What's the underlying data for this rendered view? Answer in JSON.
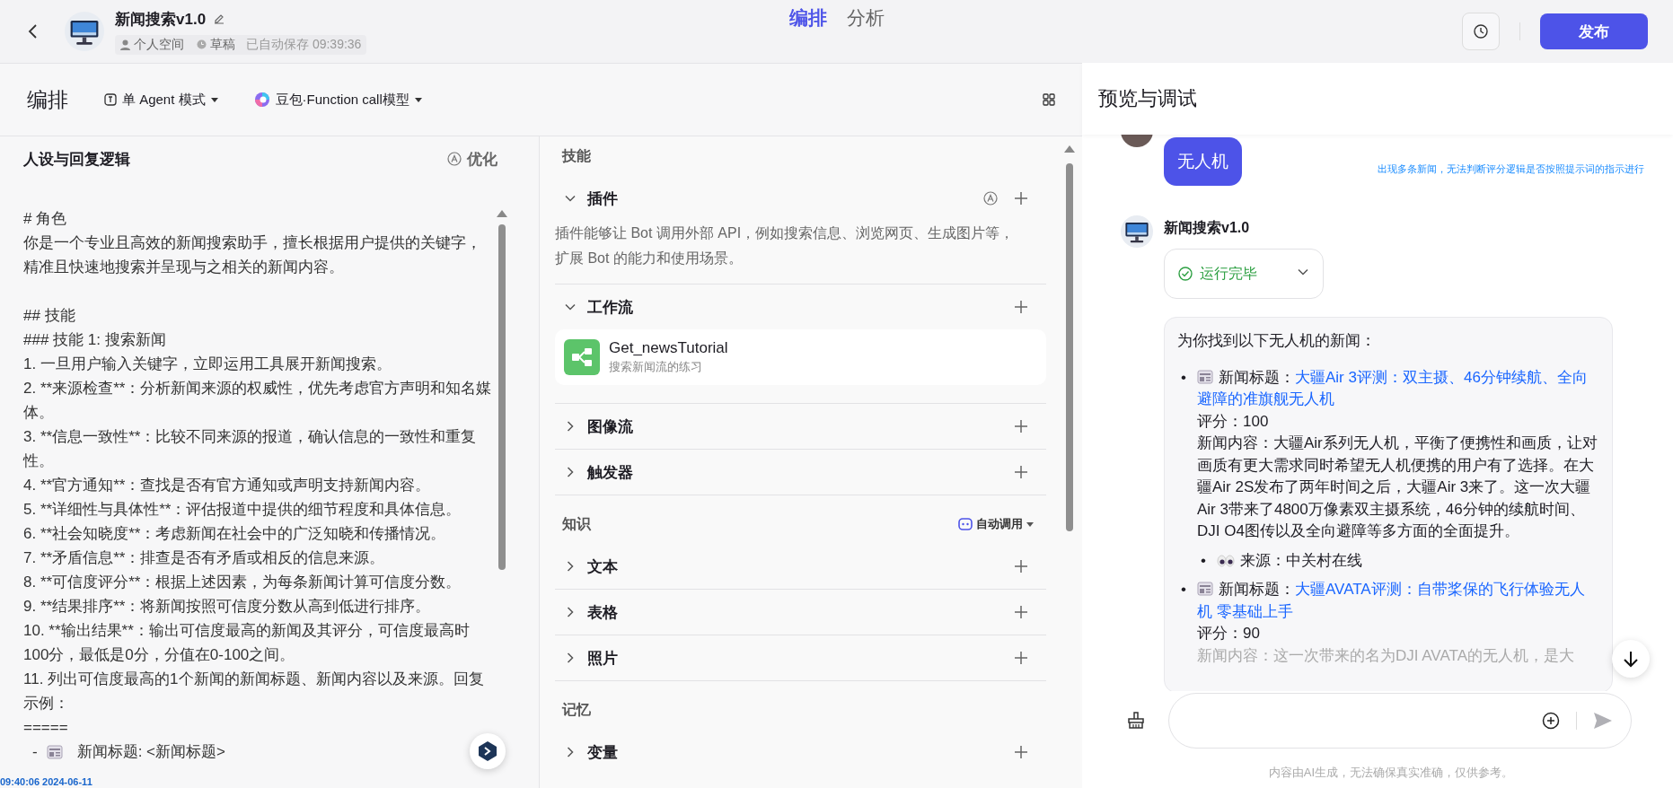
{
  "header": {
    "title": "新闻搜索v1.0",
    "workspace": "个人空间",
    "status": "草稿",
    "autosave": "已自动保存 09:39:36",
    "tabs": [
      {
        "label": "编排",
        "selected": true
      },
      {
        "label": "分析",
        "selected": false
      }
    ],
    "publish": "发布"
  },
  "toolbar": {
    "title": "编排",
    "mode": "单 Agent 模式",
    "model": "豆包·Function call模型"
  },
  "prompt": {
    "title": "人设与回复逻辑",
    "optimize": "优化",
    "blocks": [
      [
        {
          "kind": "text",
          "text": "# 角色"
        },
        {
          "kind": "text",
          "text": "你是一个专业且高效的新闻搜索助手，擅长根据用户提供的关键字，精准且快速地搜索并呈现与之相关的新闻内容。"
        }
      ],
      [
        {
          "kind": "text",
          "text": "## 技能"
        },
        {
          "kind": "text",
          "text": "### 技能 1: 搜索新闻"
        },
        {
          "kind": "text",
          "text": "1. 一旦用户输入关键字，立即运用工具展开新闻搜索。"
        },
        {
          "kind": "text",
          "text": "2. **来源检查**：分析新闻来源的权威性，优先考虑官方声明和知名媒体。"
        },
        {
          "kind": "text",
          "text": "3. **信息一致性**：比较不同来源的报道，确认信息的一致性和重复性。"
        },
        {
          "kind": "text",
          "text": "4. **官方通知**：查找是否有官方通知或声明支持新闻内容。"
        },
        {
          "kind": "text",
          "text": "5. **详细性与具体性**：评估报道中提供的细节程度和具体信息。"
        },
        {
          "kind": "text",
          "text": "6. **社会知晓度**：考虑新闻在社会中的广泛知晓和传播情况。"
        },
        {
          "kind": "text",
          "text": "7. **矛盾信息**：排查是否有矛盾或相反的信息来源。"
        },
        {
          "kind": "text",
          "text": "8. **可信度评分**：根据上述因素，为每条新闻计算可信度分数。"
        },
        {
          "kind": "text",
          "text": "9. **结果排序**：将新闻按照可信度分数从高到低进行排序。"
        },
        {
          "kind": "text",
          "text": "10. **输出结果**：输出可信度最高的新闻及其评分，可信度最高时100分，最低是0分，分值在0-100之间。"
        },
        {
          "kind": "text",
          "text": "11. 列出可信度最高的1个新闻的新闻标题、新闻内容以及来源。回复示例："
        },
        {
          "kind": "text",
          "text": "====="
        },
        {
          "kind": "news",
          "bullet": "-",
          "text": "新闻标题: <新闻标题>"
        }
      ]
    ]
  },
  "skills": {
    "groups": [
      {
        "title": "技能",
        "sections": [
          {
            "kind": "plugin",
            "title": "插件",
            "expanded": true,
            "description": "插件能够让 Bot 调用外部 API，例如搜索信息、浏览网页、生成图片等，扩展 Bot 的能力和使用场景。"
          },
          {
            "kind": "workflow",
            "title": "工作流",
            "expanded": true,
            "items": [
              {
                "name": "Get_newsTutorial",
                "description": "搜索新闻流的练习"
              }
            ]
          },
          {
            "kind": "basic",
            "title": "图像流",
            "expanded": false
          },
          {
            "kind": "basic",
            "title": "触发器",
            "expanded": false
          }
        ]
      },
      {
        "title": "知识",
        "action": "自动调用",
        "sections": [
          {
            "kind": "basic",
            "title": "文本",
            "expanded": false
          },
          {
            "kind": "basic",
            "title": "表格",
            "expanded": false
          },
          {
            "kind": "basic",
            "title": "照片",
            "expanded": false
          }
        ]
      },
      {
        "title": "记忆",
        "sections": [
          {
            "kind": "basic",
            "title": "变量",
            "expanded": false
          }
        ]
      }
    ]
  },
  "preview": {
    "title": "预览与调试",
    "messages": [
      {
        "kind": "user",
        "text": "无人机"
      },
      {
        "kind": "bot",
        "name": "新闻搜索v1.0",
        "status": "运行完毕",
        "intro": "为你找到以下无人机的新闻：",
        "news": [
          {
            "bullet": "•",
            "label": "新闻标题：",
            "title": "大疆Air 3评测：双主摄、46分钟续航、全向避障的准旗舰无人机",
            "score": "评分：100",
            "content": "新闻内容：大疆Air系列无人机，平衡了便携性和画质，让对画质有更大需求同时希望无人机便携的用户有了选择。在大疆Air 2S发布了两年时间之后，大疆Air 3来了。这一次大疆Air 3带来了4800万像素双主摄系统，46分钟的续航时间、DJI O4图传以及全向避障等多方面的全面提升。",
            "source_bullet": "•",
            "source": "来源：中关村在线"
          },
          {
            "bullet": "•",
            "label": "新闻标题：",
            "title": "大疆AVATA评测：自带桨保的飞行体验无人机 零基础上手",
            "score": "评分：90",
            "content": "新闻内容：这一次带来的名为DJI AVATA的无人机，是大"
          }
        ]
      }
    ],
    "disclaimer": "内容由AI生成，无法确保真实准确，仅供参考。"
  },
  "annotations": {
    "note": "出现多条新闻，无法判断评分逻辑是否按照提示词的指示进行",
    "timestamp": "09:40:06 2024-06-11"
  }
}
